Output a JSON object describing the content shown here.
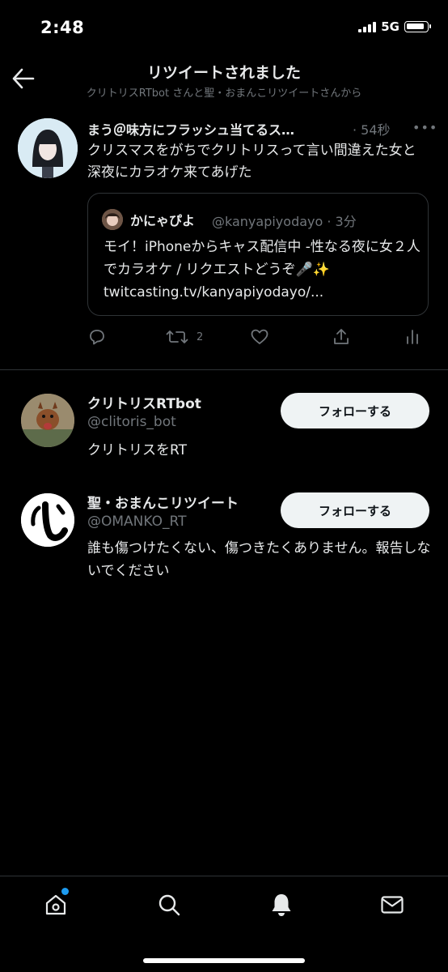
{
  "status": {
    "time": "2:48",
    "network": "5G"
  },
  "header": {
    "title": "リツイートされました",
    "subtitle": "クリトリスRTbot さんと聖・おまんこリツイートさんから"
  },
  "tweet": {
    "display_name": "まう＠味方にフラッシュ当てるス…",
    "time": "· 54秒",
    "text": "クリスマスをがちでクリトリスって言い間違えた女と深夜にカラオケ来てあげた",
    "quote": {
      "display_name": "かにゃぴよ",
      "handle": "@kanyapiyodayo · 3分",
      "text": "モイ！iPhoneからキャス配信中 -性なる夜に女２人でカラオケ / リクエストどうぞ🎤✨ twitcasting.tv/kanyapiyodayo/..."
    },
    "actions": {
      "retweet_count": "2"
    }
  },
  "users": [
    {
      "name": "クリトリスRTbot",
      "handle": "@clitoris_bot",
      "bio": "クリトリスをRT",
      "follow_label": "フォローする"
    },
    {
      "name": "聖・おまんこリツイート",
      "handle": "@OMANKO_RT",
      "bio": "誰も傷つけたくない、傷つきたくありません。報告しないでください",
      "follow_label": "フォローする"
    }
  ],
  "colors": {
    "accent": "#1d9bf0",
    "muted": "#71767b",
    "background": "#000000"
  },
  "icons": [
    "back-arrow-icon",
    "more-icon",
    "reply-icon",
    "retweet-icon",
    "like-icon",
    "share-icon",
    "analytics-icon",
    "home-icon",
    "search-icon",
    "notifications-icon",
    "messages-icon"
  ]
}
